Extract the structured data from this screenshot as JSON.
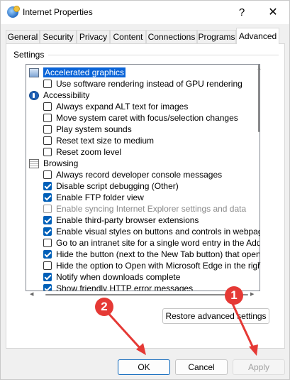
{
  "window": {
    "title": "Internet Properties",
    "help_glyph": "?",
    "close_glyph": "✕"
  },
  "tabs": [
    {
      "label": "General"
    },
    {
      "label": "Security"
    },
    {
      "label": "Privacy"
    },
    {
      "label": "Content"
    },
    {
      "label": "Connections"
    },
    {
      "label": "Programs"
    },
    {
      "label": "Advanced"
    }
  ],
  "active_tab": "Advanced",
  "settings": {
    "group_label": "Settings",
    "items": [
      {
        "type": "category",
        "icon": "graphics-icon",
        "label": "Accelerated graphics",
        "selected": true
      },
      {
        "type": "checkbox",
        "label": "Use software rendering instead of GPU rendering",
        "checked": false
      },
      {
        "type": "category",
        "icon": "accessibility-icon",
        "label": "Accessibility"
      },
      {
        "type": "checkbox",
        "label": "Always expand ALT text for images",
        "checked": false
      },
      {
        "type": "checkbox",
        "label": "Move system caret with focus/selection changes",
        "checked": false
      },
      {
        "type": "checkbox",
        "label": "Play system sounds",
        "checked": false
      },
      {
        "type": "checkbox",
        "label": "Reset text size to medium",
        "checked": false
      },
      {
        "type": "checkbox",
        "label": "Reset zoom level",
        "checked": false
      },
      {
        "type": "category",
        "icon": "browsing-icon",
        "label": "Browsing"
      },
      {
        "type": "checkbox",
        "label": "Always record developer console messages",
        "checked": false
      },
      {
        "type": "checkbox",
        "label": "Disable script debugging (Other)",
        "checked": true
      },
      {
        "type": "checkbox",
        "label": "Enable FTP folder view",
        "checked": true
      },
      {
        "type": "checkbox",
        "label": "Enable syncing Internet Explorer settings and data",
        "checked": false,
        "disabled": true
      },
      {
        "type": "checkbox",
        "label": "Enable third-party browser extensions",
        "checked": true
      },
      {
        "type": "checkbox",
        "label": "Enable visual styles on buttons and controls in webpages",
        "checked": true
      },
      {
        "type": "checkbox",
        "label": "Go to an intranet site for a single word entry in the Addres",
        "checked": false
      },
      {
        "type": "checkbox",
        "label": "Hide the button (next to the New Tab button) that opens",
        "checked": true
      },
      {
        "type": "checkbox",
        "label": "Hide the option to Open with Microsoft Edge in the right-cl",
        "checked": false
      },
      {
        "type": "checkbox",
        "label": "Notify when downloads complete",
        "checked": true
      },
      {
        "type": "checkbox",
        "label": "Show friendly HTTP error messages",
        "checked": true
      }
    ]
  },
  "buttons": {
    "restore": "Restore advanced settings",
    "ok": "OK",
    "cancel": "Cancel",
    "apply": "Apply"
  },
  "annotations": [
    {
      "label": "1",
      "color": "#e53935"
    },
    {
      "label": "2",
      "color": "#e53935"
    }
  ],
  "colors": {
    "accent": "#005fb8",
    "selection": "#0a64d8",
    "annotation": "#e53935"
  }
}
